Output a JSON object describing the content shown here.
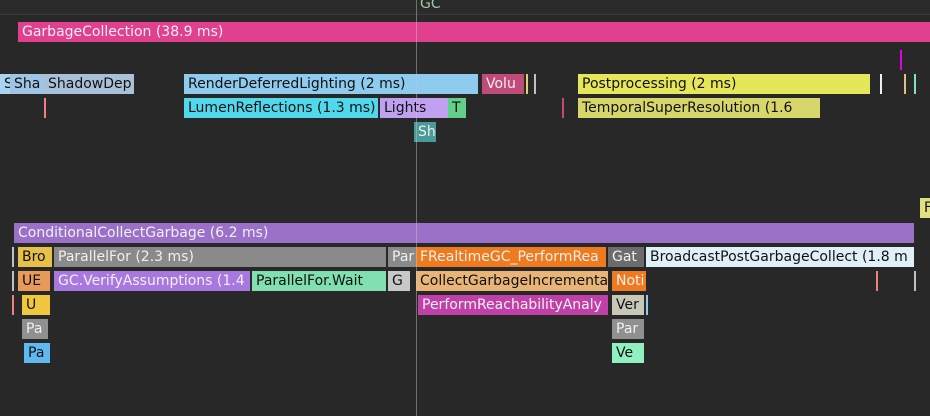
{
  "timer_label": "GC",
  "colors": {
    "background": "#282828",
    "gc_track": "#e0408f",
    "magenta": "#e100e8",
    "pink": "#d870c0",
    "teal": "#2ec8c0",
    "purple": "#a873c8"
  },
  "events": {
    "garbage_collection": "GarbageCollection (38.9 ms)",
    "s": "S",
    "sha": "Sha",
    "shadow_dep": "ShadowDep",
    "render_deferred_lighting": "RenderDeferredLighting (2 ms)",
    "volu": "Volu",
    "postprocessing": "Postprocessing (2 ms)",
    "lumen_reflections": "LumenReflections (1.3 ms)",
    "lights": "Lights",
    "t": "T",
    "temporal_super_resolution": "TemporalSuperResolution (1.6",
    "sh": "Sh",
    "f": "F",
    "conditional_collect_garbage": "ConditionalCollectGarbage (6.2 ms)",
    "bro": "Bro",
    "parallel_for": "ParallelFor (2.3 ms)",
    "par": "Par",
    "frealtime_gc": "FRealtimeGC_PerformRea",
    "gat": "Gat",
    "broadcast_post_gc": "BroadcastPostGarbageCollect (1.8 m",
    "ue": "UE",
    "gc_verify_assumptions": "GC.VerifyAssumptions (1.4",
    "parallel_for_wait": "ParallelFor.Wait",
    "g": "G",
    "collect_garbage_incremental": "CollectGarbageIncrementa",
    "noti": "Noti",
    "u": "U",
    "perform_reachability": "PerformReachabilityAnaly",
    "ver": "Ver",
    "pa1": "Pa",
    "par2": "Par",
    "pa2": "Pa",
    "ve": "Ve"
  }
}
